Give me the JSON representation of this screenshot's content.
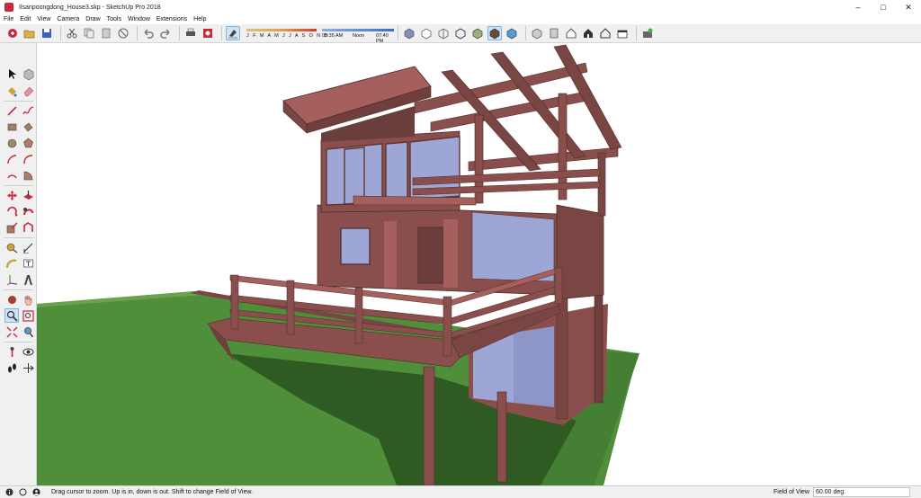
{
  "window": {
    "title": "Ilsanpoongdong_House3.skp - SketchUp Pro 2018",
    "minimize_glyph": "–",
    "maximize_glyph": "□",
    "close_glyph": "✕"
  },
  "menu": [
    "File",
    "Edit",
    "View",
    "Camera",
    "Draw",
    "Tools",
    "Window",
    "Extensions",
    "Help"
  ],
  "toolbar": {
    "shadow": {
      "months": "J F M A M J J A S O N D",
      "time_start": "05:35 AM",
      "time_noon": "Noon",
      "time_end": "07:40 PM"
    }
  },
  "status": {
    "message": "Drag cursor to zoom.  Up is in, down is out. Shift to change Field of View.",
    "measure_label": "Field of View",
    "measure_value": "60.00 deg."
  },
  "colors": {
    "wood": "#8a4f4d",
    "wood_dark": "#5e3533",
    "wood_light": "#a5605e",
    "grass": "#4f8f3a",
    "glass": "#9ea6d6"
  }
}
